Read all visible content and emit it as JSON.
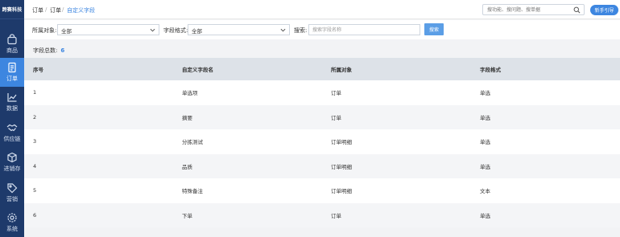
{
  "brand": {
    "logo_text": "跨赛科技"
  },
  "sidebar": {
    "items": [
      {
        "label": "商品",
        "icon": "bag-icon"
      },
      {
        "label": "订单",
        "icon": "order-doc-icon",
        "active": true
      },
      {
        "label": "数据",
        "icon": "line-chart-icon"
      },
      {
        "label": "供应链",
        "icon": "handshake-icon"
      },
      {
        "label": "进销存",
        "icon": "box-cycle-icon"
      },
      {
        "label": "营销",
        "icon": "tag-icon"
      },
      {
        "label": "系统",
        "icon": "gear-icon"
      }
    ]
  },
  "breadcrumb": {
    "items": [
      "订单",
      "订单",
      "自定义字段"
    ],
    "separator": "/"
  },
  "top_search": {
    "placeholder": "搜功能、搜问题、搜单据",
    "icon": "search-icon"
  },
  "guide_button": {
    "label": "新手引导"
  },
  "filters": {
    "owner_label": "所属对象:",
    "owner_value": "全部",
    "format_label": "字段格式:",
    "format_value": "全部",
    "keyword_label": "搜索:",
    "keyword_placeholder": "搜索字段名称",
    "search_button": "搜索"
  },
  "summary": {
    "label": "字段总数:",
    "count": "6"
  },
  "table": {
    "columns": [
      "序号",
      "自定义字段名",
      "所属对象",
      "字段格式"
    ],
    "rows": [
      [
        "1",
        "单选项",
        "订单",
        "单选"
      ],
      [
        "2",
        "摘要",
        "订单",
        "单选"
      ],
      [
        "3",
        "分拣测试",
        "订单明细",
        "单选"
      ],
      [
        "4",
        "品质",
        "订单明细",
        "单选"
      ],
      [
        "5",
        "特殊备注",
        "订单明细",
        "文本"
      ],
      [
        "6",
        "下单",
        "订单",
        "单选"
      ]
    ]
  },
  "colors": {
    "sidebar_bg": "#1e3a6b",
    "accent": "#3d86e0",
    "header_bg": "#dde2e8"
  }
}
